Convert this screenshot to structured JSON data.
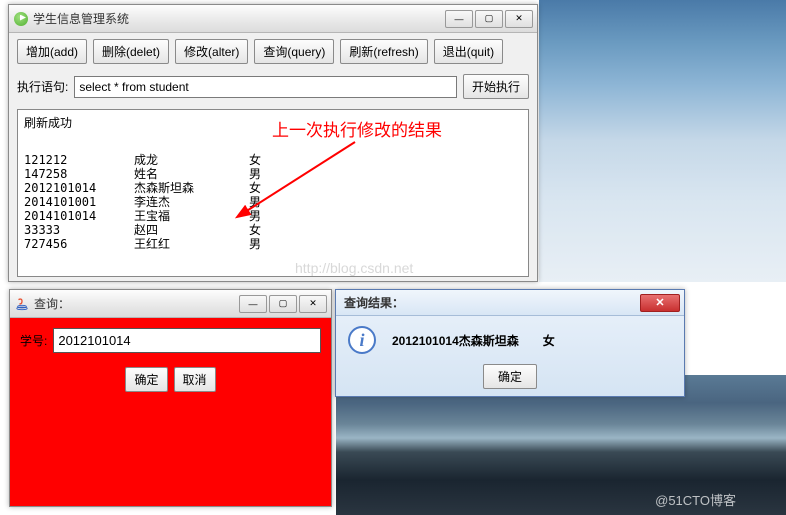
{
  "main_window": {
    "title": "学生信息管理系统",
    "toolbar": {
      "add": "增加(add)",
      "delete": "删除(delet)",
      "alter": "修改(alter)",
      "query": "查询(query)",
      "refresh": "刷新(refresh)",
      "quit": "退出(quit)"
    },
    "query_label": "执行语句:",
    "query_value": "select * from student",
    "execute": "开始执行",
    "result_status": "刷新成功",
    "rows": [
      {
        "id": "121212",
        "name": "成龙",
        "gender": "女"
      },
      {
        "id": "147258",
        "name": "姓名",
        "gender": "男"
      },
      {
        "id": "2012101014",
        "name": "杰森斯坦森",
        "gender": "女"
      },
      {
        "id": "2014101001",
        "name": "李连杰",
        "gender": "男"
      },
      {
        "id": "2014101014",
        "name": "王宝福",
        "gender": "男"
      },
      {
        "id": "33333",
        "name": "赵四",
        "gender": "女"
      },
      {
        "id": "727456",
        "name": "王红红",
        "gender": "男"
      }
    ]
  },
  "annotation": "上一次执行修改的结果",
  "query_dialog": {
    "title": "查询：",
    "field_label": "学号:",
    "field_value": "2012101014",
    "ok": "确定",
    "cancel": "取消"
  },
  "result_dialog": {
    "title": "查询结果：",
    "message": "2012101014杰森斯坦森　　女",
    "ok": "确定"
  },
  "watermark_blog": "http://blog.csdn.net",
  "watermark_bottom": "@51CTO博客"
}
